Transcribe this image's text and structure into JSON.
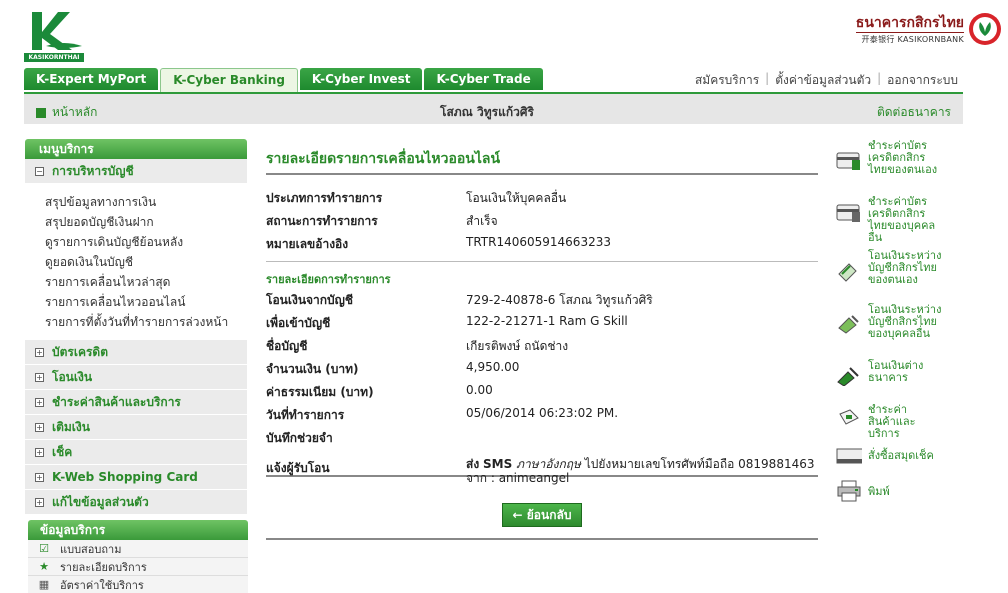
{
  "brand": {
    "logo_text": "KASIKORNTHAI",
    "bank_thai": "ธนาคารกสิกรไทย",
    "bank_eng": "开泰银行 KASIKORNBANK"
  },
  "tabs": [
    {
      "label": "K-Expert MyPort"
    },
    {
      "label": "K-Cyber Banking"
    },
    {
      "label": "K-Cyber Invest"
    },
    {
      "label": "K-Cyber Trade"
    }
  ],
  "toplinks": {
    "register": "สมัครบริการ",
    "settings": "ตั้งค่าข้อมูลส่วนตัว",
    "logout": "ออกจากระบบ"
  },
  "subbar": {
    "home": "หน้าหลัก",
    "user": "โสภณ วิทูรแก้วศิริ",
    "contact": "ติดต่อธนาคาร"
  },
  "menu": {
    "title": "เมนูบริการ",
    "account_mgmt": "การบริหารบัญชี",
    "sub": [
      "สรุปข้อมูลทางการเงิน",
      "สรุปยอดบัญชีเงินฝาก",
      "ดูรายการเดินบัญชีย้อนหลัง",
      "ดูยอดเงินในบัญชี",
      "รายการเคลื่อนไหวล่าสุด",
      "รายการเคลื่อนไหวออนไลน์",
      "รายการที่ตั้งวันที่ทำรายการล่วงหน้า"
    ],
    "groups": [
      "บัตรเครดิต",
      "โอนเงิน",
      "ชำระค่าสินค้าและบริการ",
      "เติมเงิน",
      "เช็ค",
      "K-Web Shopping Card",
      "แก้ไขข้อมูลส่วนตัว"
    ]
  },
  "services": {
    "title": "ข้อมูลบริการ",
    "items": [
      "แบบสอบถาม",
      "รายละเอียดบริการ",
      "อัตราค่าใช้บริการ"
    ]
  },
  "detail": {
    "title": "รายละเอียดรายการเคลื่อนไหวออนไลน์",
    "type_label": "ประเภทการทำรายการ",
    "type_value": "โอนเงินให้บุคคลอื่น",
    "status_label": "สถานะการทำรายการ",
    "status_value": "สำเร็จ",
    "ref_label": "หมายเลขอ้างอิง",
    "ref_value": "TRTR140605914663233",
    "section_title": "รายละเอียดการทำรายการ",
    "from_label": "โอนเงินจากบัญชี",
    "from_value": "729-2-40878-6 โสภณ วิทูรแก้วศิริ",
    "to_label": "เพื่อเข้าบัญชี",
    "to_value": "122-2-21271-1 Ram G Skill",
    "name_label": "ชื่อบัญชี",
    "name_value": "เกียรติพงษ์ ถนัดช่าง",
    "amount_label": "จำนวนเงิน (บาท)",
    "amount_value": "4,950.00",
    "fee_label": "ค่าธรรมเนียม (บาท)",
    "fee_value": "0.00",
    "date_label": "วันที่ทำรายการ",
    "date_value": "05/06/2014 06:23:02 PM.",
    "memo_label": "บันทึกช่วยจำ",
    "memo_value": "",
    "notify_label": "แจ้งผู้รับโอน",
    "notify_part1": "ส่ง",
    "notify_part2": "SMS",
    "notify_part3": "ภาษาอังกฤษ",
    "notify_part4": " ไปยังหมายเลขโทรศัพท์มือถือ 0819881463",
    "notify_from": "จาก : animeangel",
    "back_button": "← ย้อนกลับ"
  },
  "right": [
    {
      "label": "ชำระค่าบัตรเครดิตกสิกรไทยของตนเอง",
      "icon": "credit-card-icon"
    },
    {
      "label": "ชำระค่าบัตรเครดิตกสิกรไทยของบุคคลอื่น",
      "icon": "credit-card-icon"
    },
    {
      "label": "โอนเงินระหว่างบัญชีกสิกรไทยของตนเอง",
      "icon": "transfer-icon"
    },
    {
      "label": "โอนเงินระหว่างบัญชีกสิกรไทยของบุคคลอื่น",
      "icon": "transfer-icon"
    },
    {
      "label": "โอนเงินต่างธนาคาร",
      "icon": "interbank-icon"
    },
    {
      "label": "ชำระค่าสินค้าและบริการ",
      "icon": "payment-icon"
    },
    {
      "label": "สั่งซื้อสมุดเช็ค",
      "icon": "cheque-icon"
    },
    {
      "label": "พิมพ์",
      "icon": "printer-icon"
    }
  ]
}
